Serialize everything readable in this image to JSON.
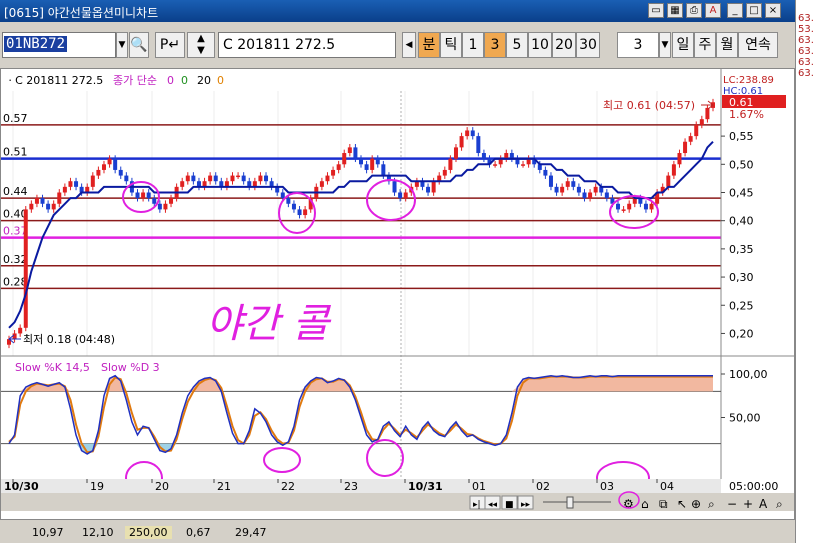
{
  "window": {
    "title": "[0615] 야간선물옵션미니차트"
  },
  "toolbar": {
    "code_value": "01NB272",
    "p_label": "P",
    "name_value": "C 201811 272.5",
    "periods": [
      {
        "label": "분",
        "active": true
      },
      {
        "label": "틱",
        "active": false
      },
      {
        "label": "1",
        "active": false
      },
      {
        "label": "3",
        "active": true
      },
      {
        "label": "5",
        "active": false
      },
      {
        "label": "10",
        "active": false
      },
      {
        "label": "20",
        "active": false
      },
      {
        "label": "30",
        "active": false
      }
    ],
    "count_value": "3",
    "range_labels": [
      "일",
      "주",
      "월",
      "연속"
    ]
  },
  "right_strip": {
    "values": [
      "63.",
      "53.",
      "63.",
      "63.",
      "63.",
      "63."
    ]
  },
  "legend": {
    "series": "C 201811 272.5",
    "item1": "종가 단순",
    "ma1": "0",
    "ma2": "0",
    "ma3": "20",
    "ma4": "0"
  },
  "price_tags": {
    "lc": "LC:238.89",
    "hc": "HC:0.61",
    "current": "0.61",
    "change": "1.67%"
  },
  "annotations": {
    "high": "최고 0.61 (04:57)",
    "low": "최저 0.18 (04:48)",
    "handwriting": "야간 콜"
  },
  "stochastic": {
    "label_k": "Slow %K 14,5",
    "label_d": "Slow %D 3"
  },
  "footer_time": "05:00:00",
  "status": {
    "values": [
      "10,97",
      "12,10",
      "250,00",
      "0,67",
      "29,47"
    ]
  },
  "colors": {
    "up": "#e02020",
    "down": "#1a3fd0",
    "ma": "#0a1aa0",
    "level": "#8b1a1a",
    "magenta": "#e020e0",
    "stoch_k": "#2030c0",
    "stoch_d": "#e07a10"
  },
  "chart_data": {
    "type": "candlestick",
    "left_axis_labels": [
      "0.57",
      "0.51",
      "0.44",
      "0.40",
      "0.37",
      "0.32",
      "0.28"
    ],
    "y_ticks": [
      "0,55",
      "0,50",
      "0,45",
      "0,40",
      "0,35",
      "0,30",
      "0,25",
      "0,20"
    ],
    "ylim": [
      0.16,
      0.63
    ],
    "x_ticks": [
      "10/30",
      "19",
      "20",
      "21",
      "22",
      "23",
      "10/31",
      "01",
      "02",
      "03",
      "04"
    ],
    "horizontal_levels": [
      {
        "value": 0.57,
        "color": "#8b1a1a"
      },
      {
        "value": 0.51,
        "color": "#1a2fd0"
      },
      {
        "value": 0.44,
        "color": "#8b1a1a"
      },
      {
        "value": 0.4,
        "color": "#8b1a1a"
      },
      {
        "value": 0.37,
        "color": "#e020e0"
      },
      {
        "value": 0.32,
        "color": "#8b1a1a"
      },
      {
        "value": 0.28,
        "color": "#8b1a1a"
      }
    ],
    "close": [
      0.19,
      0.2,
      0.21,
      0.42,
      0.43,
      0.44,
      0.43,
      0.42,
      0.43,
      0.45,
      0.46,
      0.47,
      0.46,
      0.45,
      0.46,
      0.48,
      0.49,
      0.5,
      0.51,
      0.49,
      0.48,
      0.47,
      0.45,
      0.44,
      0.45,
      0.44,
      0.43,
      0.42,
      0.43,
      0.44,
      0.46,
      0.47,
      0.48,
      0.47,
      0.46,
      0.47,
      0.48,
      0.47,
      0.46,
      0.47,
      0.48,
      0.48,
      0.47,
      0.46,
      0.47,
      0.48,
      0.47,
      0.46,
      0.45,
      0.44,
      0.43,
      0.42,
      0.41,
      0.42,
      0.44,
      0.46,
      0.47,
      0.48,
      0.49,
      0.5,
      0.52,
      0.53,
      0.51,
      0.5,
      0.49,
      0.51,
      0.5,
      0.48,
      0.47,
      0.45,
      0.44,
      0.45,
      0.46,
      0.47,
      0.46,
      0.45,
      0.47,
      0.48,
      0.49,
      0.51,
      0.53,
      0.55,
      0.56,
      0.55,
      0.52,
      0.51,
      0.5,
      0.5,
      0.51,
      0.52,
      0.51,
      0.5,
      0.5,
      0.51,
      0.5,
      0.49,
      0.48,
      0.46,
      0.45,
      0.46,
      0.47,
      0.46,
      0.45,
      0.44,
      0.45,
      0.46,
      0.45,
      0.44,
      0.43,
      0.42,
      0.42,
      0.43,
      0.44,
      0.43,
      0.42,
      0.43,
      0.45,
      0.46,
      0.48,
      0.5,
      0.52,
      0.54,
      0.55,
      0.57,
      0.58,
      0.6,
      0.61
    ],
    "ma": [
      0.21,
      0.22,
      0.24,
      0.27,
      0.31,
      0.34,
      0.37,
      0.39,
      0.41,
      0.42,
      0.43,
      0.44,
      0.44,
      0.45,
      0.45,
      0.45,
      0.45,
      0.46,
      0.46,
      0.46,
      0.46,
      0.46,
      0.46,
      0.46,
      0.46,
      0.46,
      0.45,
      0.45,
      0.45,
      0.45,
      0.45,
      0.45,
      0.45,
      0.46,
      0.46,
      0.46,
      0.46,
      0.46,
      0.46,
      0.46,
      0.46,
      0.46,
      0.46,
      0.46,
      0.46,
      0.46,
      0.46,
      0.46,
      0.46,
      0.46,
      0.45,
      0.45,
      0.45,
      0.45,
      0.45,
      0.45,
      0.45,
      0.45,
      0.45,
      0.46,
      0.46,
      0.47,
      0.47,
      0.47,
      0.47,
      0.48,
      0.48,
      0.48,
      0.48,
      0.48,
      0.48,
      0.48,
      0.47,
      0.47,
      0.47,
      0.47,
      0.47,
      0.47,
      0.47,
      0.47,
      0.48,
      0.48,
      0.49,
      0.49,
      0.5,
      0.5,
      0.5,
      0.51,
      0.51,
      0.51,
      0.51,
      0.51,
      0.51,
      0.51,
      0.51,
      0.5,
      0.5,
      0.5,
      0.49,
      0.49,
      0.48,
      0.48,
      0.48,
      0.47,
      0.47,
      0.47,
      0.46,
      0.46,
      0.46,
      0.45,
      0.45,
      0.45,
      0.44,
      0.44,
      0.44,
      0.44,
      0.45,
      0.45,
      0.46,
      0.46,
      0.47,
      0.48,
      0.49,
      0.5,
      0.51,
      0.53,
      0.54
    ],
    "stoch_yticks": [
      "100,00",
      "50,00"
    ],
    "stoch_k": [
      20,
      30,
      75,
      85,
      88,
      90,
      88,
      86,
      88,
      90,
      85,
      60,
      30,
      12,
      8,
      12,
      35,
      75,
      95,
      98,
      92,
      70,
      45,
      30,
      40,
      38,
      25,
      12,
      10,
      14,
      30,
      55,
      75,
      85,
      92,
      95,
      96,
      92,
      80,
      55,
      32,
      20,
      20,
      35,
      60,
      55,
      45,
      30,
      22,
      18,
      22,
      40,
      70,
      85,
      92,
      96,
      95,
      90,
      92,
      95,
      93,
      85,
      70,
      50,
      30,
      22,
      25,
      40,
      45,
      35,
      28,
      40,
      30,
      25,
      38,
      45,
      35,
      30,
      28,
      38,
      45,
      35,
      28,
      30,
      25,
      22,
      20,
      18,
      20,
      30,
      55,
      85,
      94,
      96,
      95,
      96,
      97,
      98,
      97,
      98,
      97,
      96,
      96,
      97,
      98,
      97,
      98,
      98,
      97,
      98,
      98,
      98,
      98,
      98,
      98,
      98,
      98,
      98,
      98,
      98,
      98,
      98,
      98,
      98,
      98,
      98,
      98
    ],
    "stoch_d": [
      22,
      28,
      65,
      80,
      86,
      89,
      88,
      87,
      88,
      89,
      86,
      70,
      42,
      20,
      10,
      11,
      28,
      62,
      88,
      96,
      94,
      78,
      55,
      36,
      38,
      38,
      28,
      16,
      11,
      12,
      25,
      48,
      68,
      80,
      89,
      93,
      95,
      93,
      84,
      63,
      40,
      24,
      20,
      30,
      52,
      56,
      48,
      35,
      25,
      20,
      21,
      35,
      62,
      80,
      90,
      94,
      95,
      91,
      91,
      94,
      93,
      87,
      74,
      56,
      36,
      25,
      24,
      36,
      43,
      37,
      30,
      36,
      32,
      27,
      35,
      42,
      37,
      32,
      29,
      35,
      42,
      37,
      31,
      30,
      26,
      23,
      21,
      19,
      20,
      26,
      46,
      75,
      90,
      95,
      95,
      95,
      96,
      97,
      97,
      97,
      97,
      96,
      96,
      96,
      97,
      97,
      97,
      97,
      97,
      97,
      97,
      97,
      97,
      97,
      97,
      97,
      97,
      97,
      97,
      97,
      97,
      97,
      97,
      97,
      97,
      97,
      97
    ]
  }
}
